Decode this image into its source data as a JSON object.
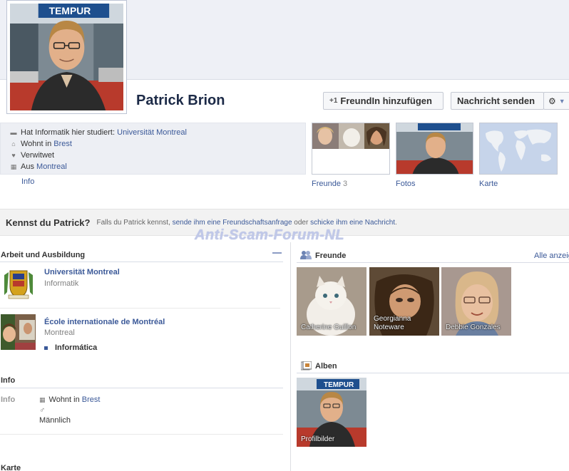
{
  "profile": {
    "name": "Patrick Brion",
    "cover_brand": "TEMPUR"
  },
  "actions": {
    "add_friend": "FreundIn hinzufügen",
    "send_message": "Nachricht senden",
    "add_friend_icon": "add-friend-icon",
    "gear_icon": "gear-icon"
  },
  "intro": {
    "studied_prefix": "Hat Informatik hier studiert:",
    "studied_link": "Universität Montreal",
    "lives_prefix": "Wohnt in",
    "lives_link": "Brest",
    "relationship": "Verwitwet",
    "from_prefix": "Aus",
    "from_link": "Montreal",
    "info_link": "Info"
  },
  "thumbnails": {
    "friends_label": "Freunde",
    "friends_count": "3",
    "photos_label": "Fotos",
    "map_label": "Karte"
  },
  "know_bar": {
    "question": "Kennst du Patrick?",
    "text_1": "Falls du Patrick kennst,",
    "link_1": "sende ihm eine Freundschaftsanfrage",
    "text_2": "oder",
    "link_2": "schicke ihm eine Nachricht",
    "text_3": "."
  },
  "watermark": "Anti-Scam-Forum-NL",
  "work_education": {
    "heading": "Arbeit und Ausbildung",
    "entries": [
      {
        "title": "Universität Montreal",
        "sub": "Informatik"
      },
      {
        "title": "École internationale de Montréal",
        "sub": "Montreal",
        "bullet": "Informática"
      }
    ]
  },
  "info_section": {
    "heading": "Info",
    "label": "Info",
    "lives_prefix": "Wohnt in",
    "lives_link": "Brest",
    "gender_symbol": "♂",
    "gender": "Männlich"
  },
  "map_section": {
    "heading": "Karte"
  },
  "friends_section": {
    "heading": "Freunde",
    "see_all": "Alle anzeig",
    "friends": [
      {
        "name": "Catherine Guillon"
      },
      {
        "name_line1": "Georgianna",
        "name_line2": "Noteware"
      },
      {
        "name": "Debbie Gonzales"
      }
    ]
  },
  "albums_section": {
    "heading": "Alben",
    "albums": [
      {
        "name": "Profilbilder"
      }
    ]
  },
  "colors": {
    "link": "#3b5998",
    "cover": "#eef0f6",
    "infobox": "#edeff4"
  }
}
